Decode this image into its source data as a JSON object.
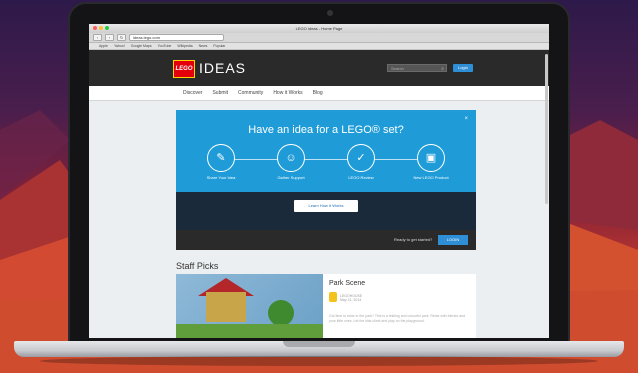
{
  "browser": {
    "window_title": "LEGO Ideas - Home Page",
    "address": "ideas.lego.com",
    "bookmarks": [
      "Apple",
      "Yahoo!",
      "Google Maps",
      "YouTube",
      "Wikipedia",
      "News",
      "Popular"
    ],
    "nav_back": "‹",
    "nav_forward": "›",
    "reload": "↻"
  },
  "site": {
    "logo": "LEGO",
    "brand": "IDEAS",
    "search_placeholder": "Search",
    "login_label": "Login",
    "nav": [
      "Discover",
      "Submit",
      "Community",
      "How it Works",
      "Blog"
    ]
  },
  "hero": {
    "title": "Have an idea for a LEGO® set?",
    "close": "×",
    "steps": [
      {
        "label": "Share Your Idea",
        "icon": "✎"
      },
      {
        "label": "Gather Support",
        "icon": "☺"
      },
      {
        "label": "LEGO Review",
        "icon": "✓"
      },
      {
        "label": "New LEGO Product",
        "icon": "▣"
      }
    ],
    "learn_label": "Learn How It Works",
    "ready_text": "Ready to get started?",
    "login_label": "LOGIN"
  },
  "staff_picks": {
    "heading": "Staff Picks",
    "item": {
      "title": "Park Scene",
      "author": "LEGOHOUSE",
      "date": "May 21, 2014",
      "description": "Got time to relax in the park? This is a tinkling and colourful park. Relax with friends and your little ones. Let the kids climb and play on the playground."
    }
  },
  "colors": {
    "accent": "#1f9cd8",
    "header": "#2a2a2a",
    "lego_red": "#e3000b",
    "button_blue": "#2f8fd6"
  }
}
